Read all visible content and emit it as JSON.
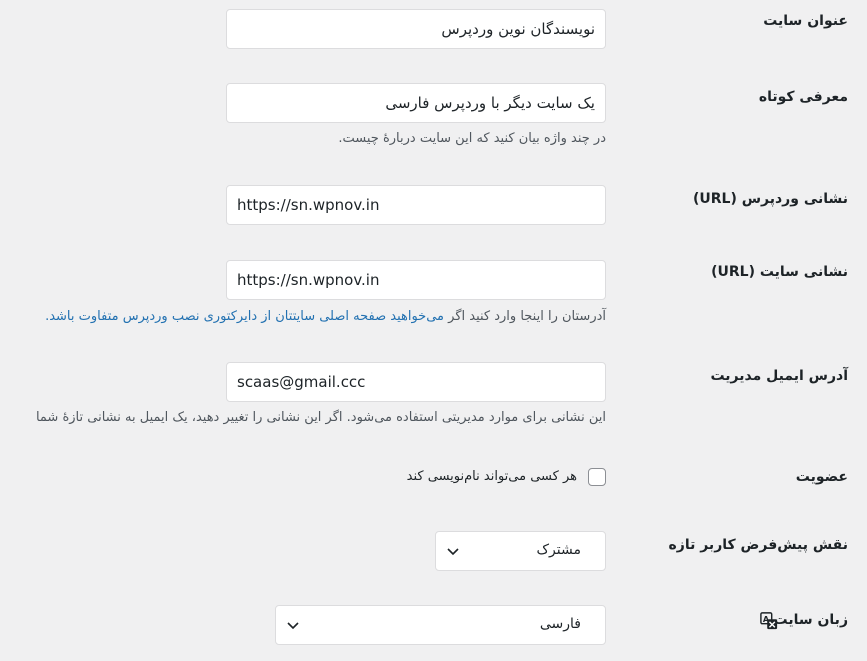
{
  "site_title": {
    "label": "عنوان سایت",
    "value": "نویسندگان نوین وردپرس"
  },
  "tagline": {
    "label": "معرفی کوتاه",
    "value": "یک سایت دیگر با وردپرس فارسی",
    "description": "در چند واژه بیان کنید که این سایت دربارهٔ چیست."
  },
  "wp_url": {
    "label": "نشانی وردپرس (URL)",
    "value": "https://sn.wpnov.in"
  },
  "site_url": {
    "label": "نشانی سایت (URL)",
    "value": "https://sn.wpnov.in",
    "description_prefix": "آدرستان را اینجا وارد کنید اگر ",
    "description_link": "می‌خواهید صفحه اصلی سایتتان از دایرکتوری نصب وردپرس متفاوت باشد."
  },
  "admin_email": {
    "label": "آدرس ایمیل مدیریت",
    "value": "scaas@gmail.ccc",
    "description": "این نشانی برای موارد مدیریتی استفاده می‌شود. اگر این نشانی را تغییر دهید، یک ایمیل به نشانی تازهٔ شما"
  },
  "membership": {
    "label": "عضویت",
    "checkbox_label": "هر کسی می‌تواند نام‌نویسی کند",
    "checked": false
  },
  "default_role": {
    "label": "نقش پیش‌فرض کاربر تازه",
    "selected": "مشترک"
  },
  "site_language": {
    "label": "زبان سایت",
    "icon": "translation-icon",
    "selected": "فارسی"
  },
  "colors": {
    "background": "#f0f0f1",
    "link": "#2271b1",
    "border": "#dcdcde",
    "text": "#1d2327",
    "description": "#50575e"
  }
}
